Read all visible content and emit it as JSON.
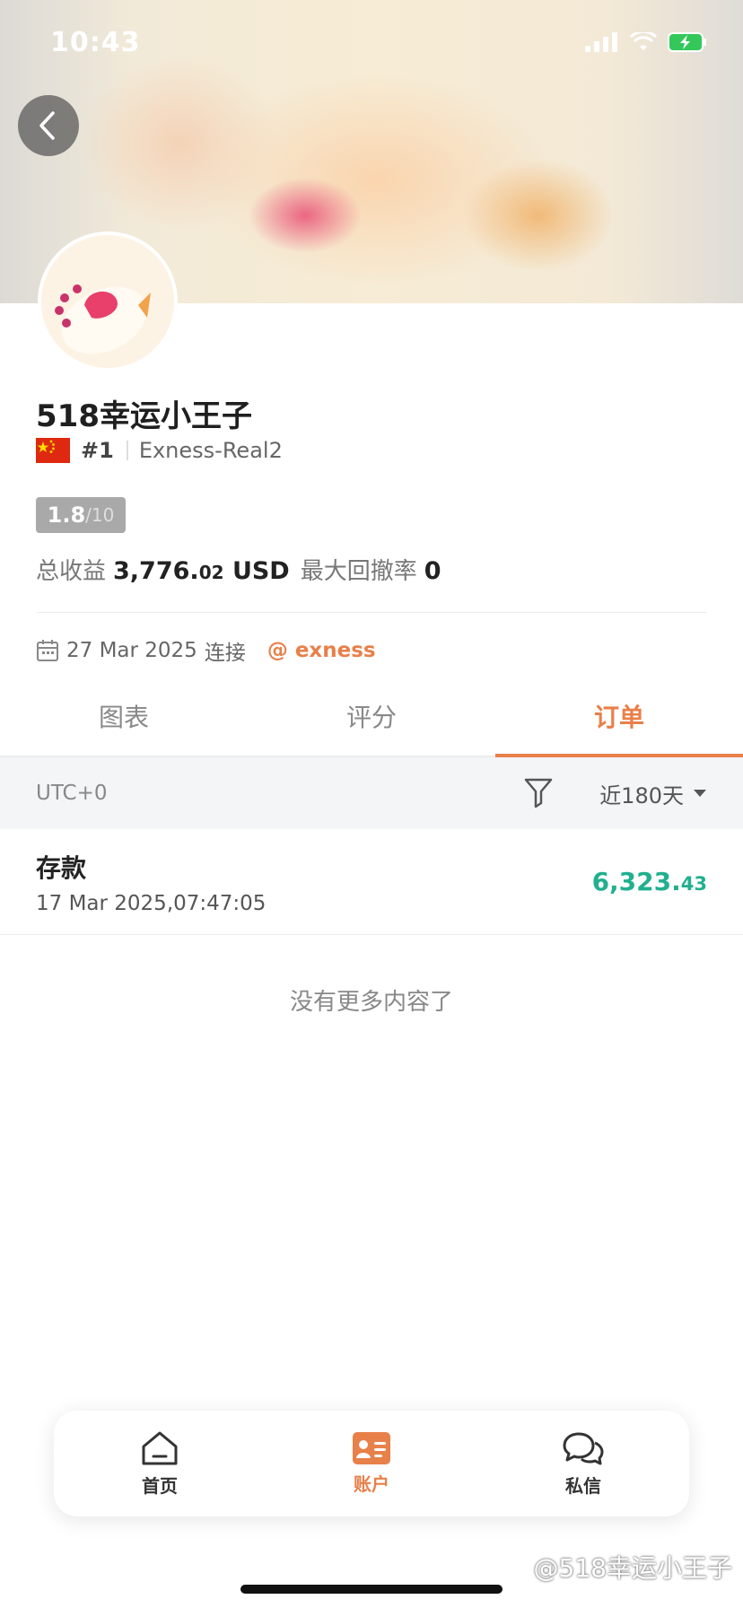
{
  "status_bar": {
    "time": "10:43"
  },
  "profile": {
    "name": "518幸运小王子",
    "rank": "#1",
    "account": "Exness-Real2",
    "score": "1.8",
    "score_max": "/10",
    "total_profit_label": "总收益",
    "total_profit_main": "3,776.",
    "total_profit_cents": "02",
    "total_profit_currency": "USD",
    "max_drawdown_label": "最大回撤率",
    "max_drawdown_value": "0",
    "connect_date": "27 Mar 2025",
    "connect_label": "连接",
    "broker": "@ exness"
  },
  "tabs": [
    {
      "label": "图表",
      "active": false
    },
    {
      "label": "评分",
      "active": false
    },
    {
      "label": "订单",
      "active": true
    }
  ],
  "filter": {
    "timezone": "UTC+0",
    "range": "近180天"
  },
  "orders": [
    {
      "type": "存款",
      "datetime": "17 Mar 2025,07:47:05",
      "amount_main": "6,323.",
      "amount_cents": "43"
    }
  ],
  "no_more_text": "没有更多内容了",
  "bottom_nav": [
    {
      "label": "首页",
      "icon": "home-icon",
      "active": false
    },
    {
      "label": "账户",
      "icon": "account-card-icon",
      "active": true
    },
    {
      "label": "私信",
      "icon": "chat-bubbles-icon",
      "active": false
    }
  ],
  "watermark": "@518幸运小王子",
  "colors": {
    "accent": "#e8804a",
    "positive": "#21b08f"
  }
}
